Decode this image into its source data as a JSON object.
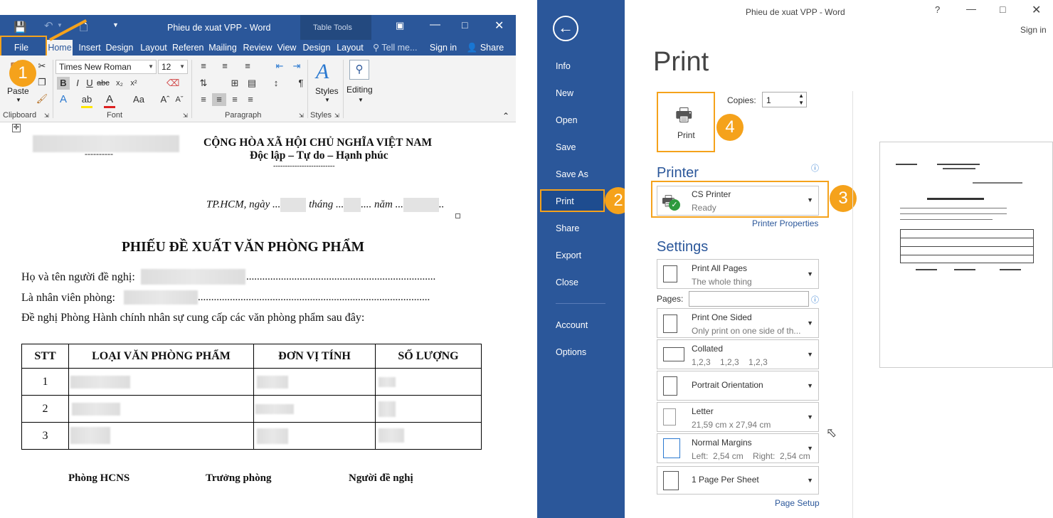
{
  "left_window": {
    "title": "Phieu de xuat VPP - Word",
    "table_tools": "Table Tools",
    "tabs": [
      "File",
      "Home",
      "Insert",
      "Design",
      "Layout",
      "Referen",
      "Mailing",
      "Review",
      "View",
      "Design",
      "Layout"
    ],
    "tell_me": "Tell me...",
    "sign_in": "Sign in",
    "share": "Share",
    "font_name": "Times New Roman",
    "font_size": "12",
    "groups": {
      "clipboard": "Clipboard",
      "font": "Font",
      "paragraph": "Paragraph",
      "styles": "Styles"
    },
    "paste_label": "Paste",
    "styles_label": "Styles",
    "editing_label": "Editing"
  },
  "document": {
    "company_dash": "----------",
    "nation_title": "CỘNG HÒA XÃ HỘI CHỦ NGHĨA VIỆT NAM",
    "nation_motto": "Độc lập – Tự do – Hạnh phúc",
    "motto_rule": "--------------------------",
    "date_prefix": "TP.HCM, ngày ...",
    "date_month": "tháng ...",
    "date_year": ".... năm ...",
    "date_end": "..",
    "form_title": "PHIẾU ĐỀ XUẤT VĂN PHÒNG PHẨM",
    "line1_label": "Họ và tên người đề nghị:",
    "line2_label": "Là nhân viên phòng:",
    "line3": "Đề nghị Phòng Hành chính nhân sự cung cấp các văn phòng phẩm sau đây:",
    "dots": ".......................................................................",
    "dots2": ".......................................................................................",
    "table_headers": [
      "STT",
      "LOẠI VĂN PHÒNG PHẨM",
      "ĐƠN VỊ TÍNH",
      "SỐ LƯỢNG"
    ],
    "table_rows": [
      "1",
      "2",
      "3"
    ],
    "signatures": [
      "Phòng HCNS",
      "Trưởng phòng",
      "Người đề nghị"
    ]
  },
  "badges": [
    "1",
    "2",
    "3",
    "4"
  ],
  "backstage": {
    "title": "Phieu de xuat VPP - Word",
    "help": "?",
    "sign_in": "Sign in",
    "nav": [
      "Info",
      "New",
      "Open",
      "Save",
      "Save As",
      "Print",
      "Share",
      "Export",
      "Close",
      "Account",
      "Options"
    ],
    "heading": "Print",
    "print_button": "Print",
    "copies_label": "Copies:",
    "copies_value": "1",
    "printer_heading": "Printer",
    "printer_name": "CS Printer",
    "printer_status": "Ready",
    "printer_properties": "Printer Properties",
    "settings_heading": "Settings",
    "pages_label": "Pages:",
    "settings": [
      {
        "t1": "Print All Pages",
        "t2": "The whole thing"
      },
      {
        "t1": "Print One Sided",
        "t2": "Only print on one side of th..."
      },
      {
        "t1": "Collated",
        "t2": "1,2,3    1,2,3    1,2,3"
      },
      {
        "t1": "Portrait Orientation",
        "t2": ""
      },
      {
        "t1": "Letter",
        "t2": "21,59 cm x 27,94 cm"
      },
      {
        "t1": "Normal Margins",
        "t2": "Left:  2,54 cm    Right:  2,54 cm"
      },
      {
        "t1": "1 Page Per Sheet",
        "t2": ""
      }
    ],
    "page_setup": "Page Setup"
  },
  "colors": {
    "word_blue": "#2b579a",
    "highlight": "#f5a21b"
  }
}
